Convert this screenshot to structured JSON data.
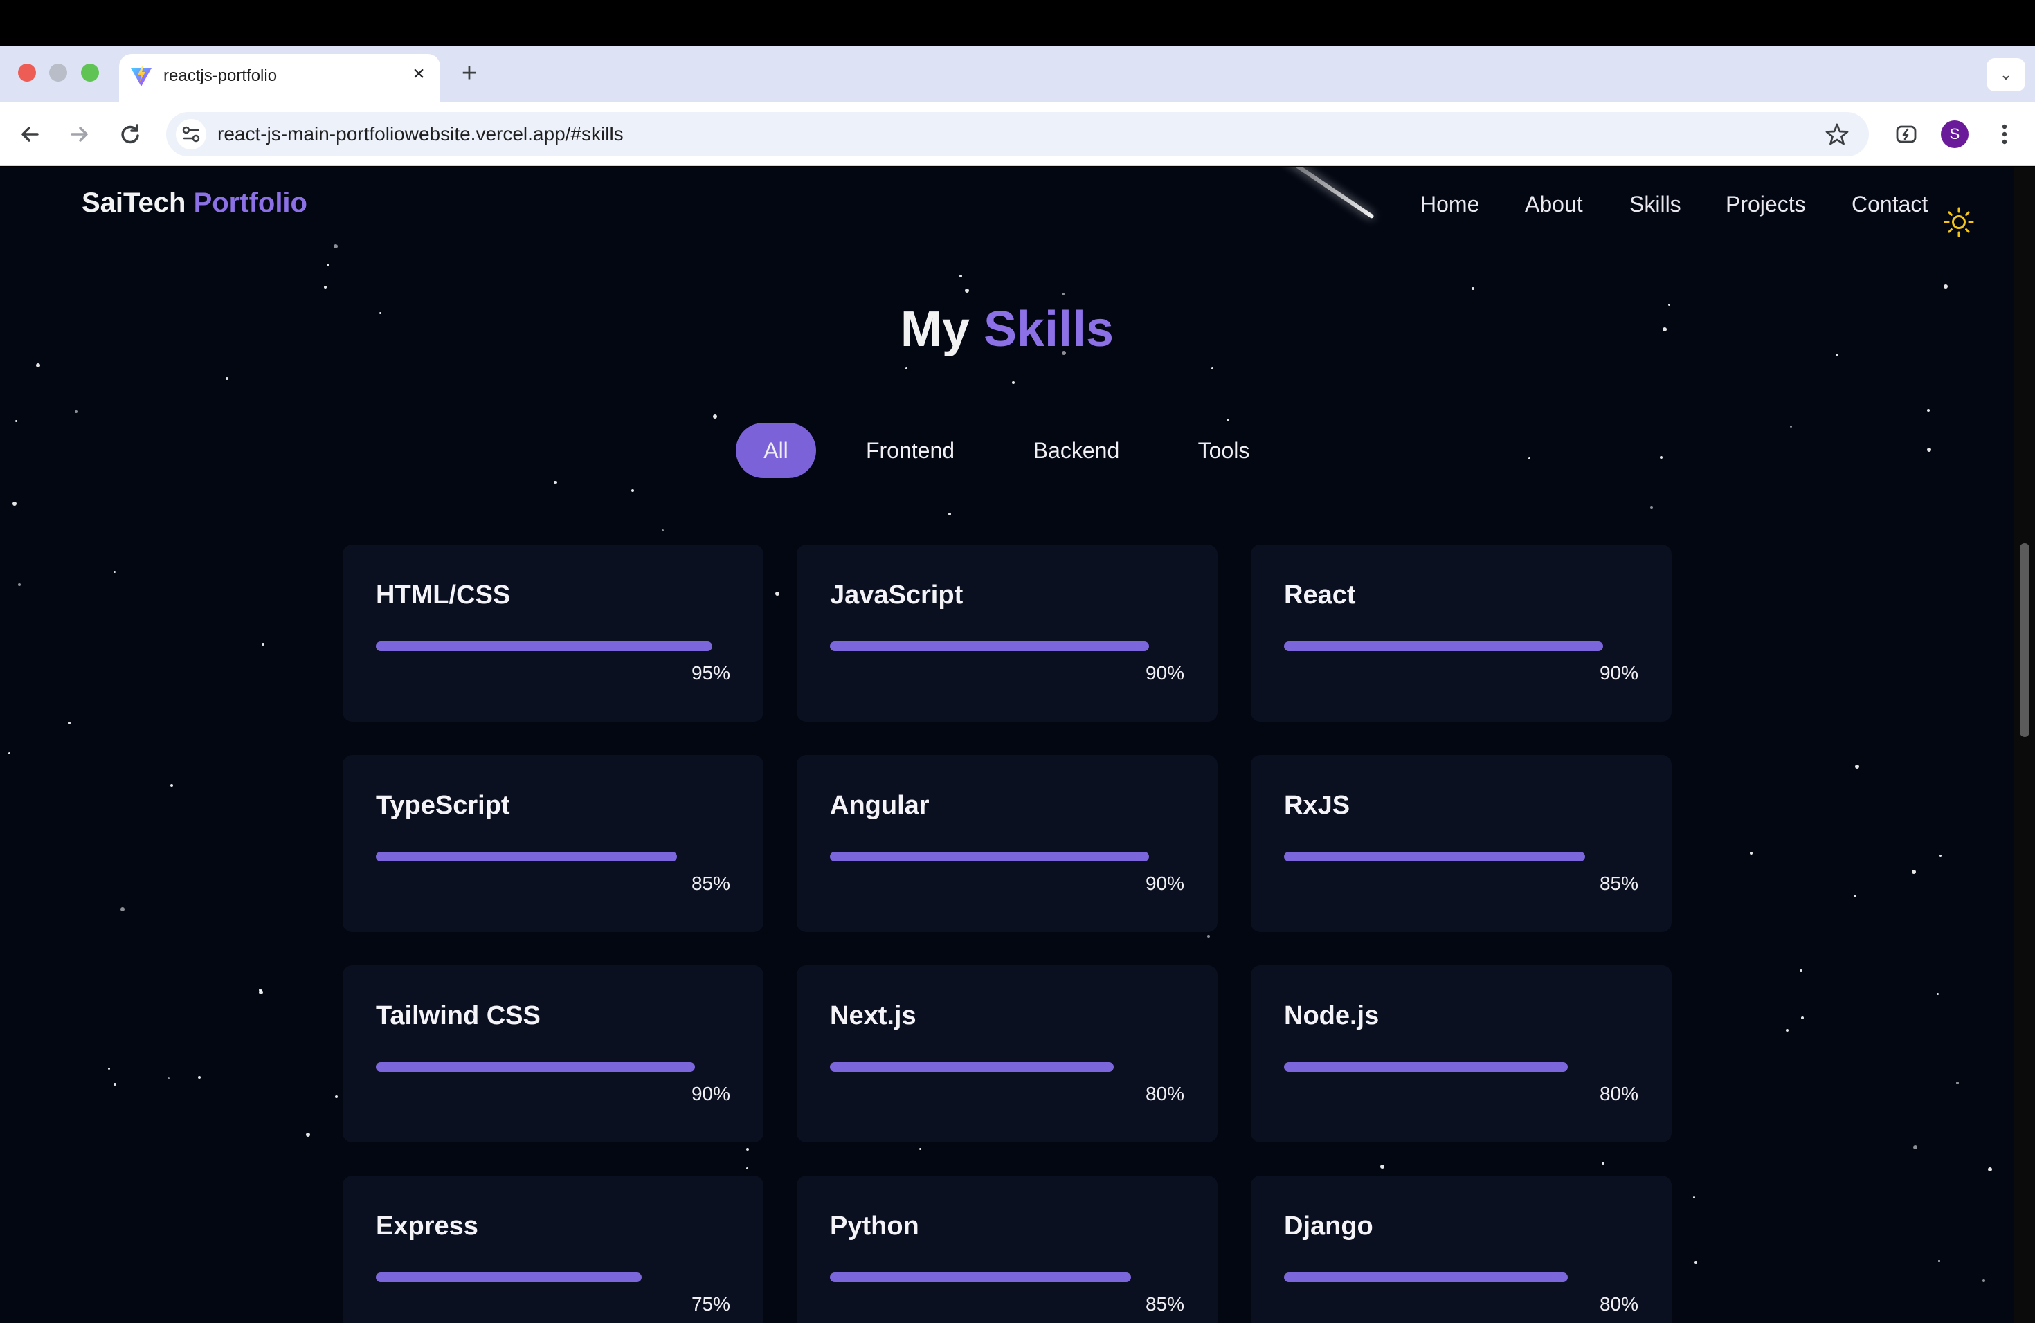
{
  "browser": {
    "tab_title": "reactjs-portfolio",
    "tab_close": "×",
    "new_tab": "+",
    "url": "react-js-main-portfoliowebsite.vercel.app/#skills",
    "profile_initial": "S"
  },
  "header": {
    "brand_primary": "SaiTech",
    "brand_accent": "Portfolio",
    "nav": [
      "Home",
      "About",
      "Skills",
      "Projects",
      "Contact"
    ]
  },
  "section": {
    "title_primary": "My",
    "title_accent": "Skills"
  },
  "filters": [
    "All",
    "Frontend",
    "Backend",
    "Tools"
  ],
  "active_filter": "All",
  "skills": [
    {
      "name": "HTML/CSS",
      "level": 95,
      "label": "95%"
    },
    {
      "name": "JavaScript",
      "level": 90,
      "label": "90%"
    },
    {
      "name": "React",
      "level": 90,
      "label": "90%"
    },
    {
      "name": "TypeScript",
      "level": 85,
      "label": "85%"
    },
    {
      "name": "Angular",
      "level": 90,
      "label": "90%"
    },
    {
      "name": "RxJS",
      "level": 85,
      "label": "85%"
    },
    {
      "name": "Tailwind CSS",
      "level": 90,
      "label": "90%"
    },
    {
      "name": "Next.js",
      "level": 80,
      "label": "80%"
    },
    {
      "name": "Node.js",
      "level": 80,
      "label": "80%"
    },
    {
      "name": "Express",
      "level": 75,
      "label": "75%"
    },
    {
      "name": "Python",
      "level": 85,
      "label": "85%"
    },
    {
      "name": "Django",
      "level": 80,
      "label": "80%"
    }
  ],
  "colors": {
    "page_bg": "#030712",
    "accent": "#8b70e6",
    "card_bg": "#0b1020",
    "bar": "#7c66dc",
    "theme_icon": "#f5c518"
  },
  "icons": {
    "favicon": "vite-logo-icon",
    "back": "arrow-left-icon",
    "forward": "arrow-right-icon",
    "reload": "reload-icon",
    "site_info": "tune-icon",
    "bookmark": "star-icon",
    "extension": "extension-icon",
    "menu": "kebab-menu-icon",
    "theme": "sun-icon"
  }
}
